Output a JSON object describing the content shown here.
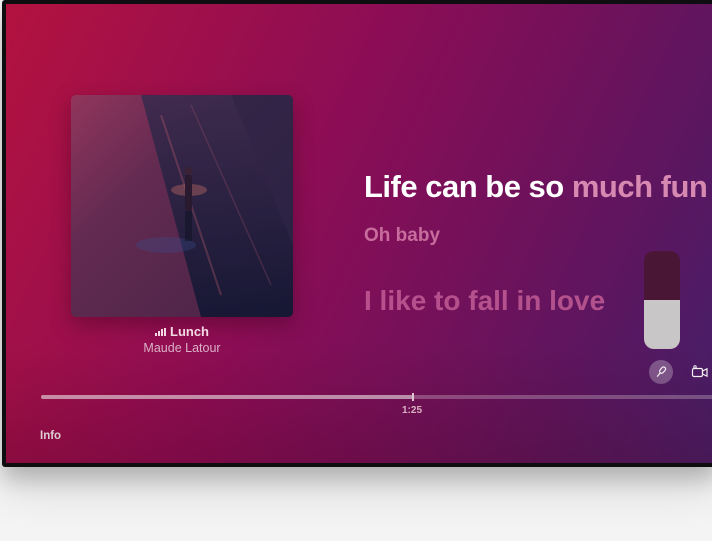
{
  "now_playing": {
    "title": "Lunch",
    "artist": "Maude Latour",
    "playing_indicator_icon": "equalizer-bars-icon"
  },
  "lyrics": {
    "current_sung": "Life can be so",
    "current_unsung": " much fun",
    "next": "Oh baby",
    "later": "I like to fall in love"
  },
  "playback": {
    "elapsed": "1:25",
    "progress": 0.55
  },
  "controls": {
    "info_label": "Info",
    "mic_icon": "microphone-icon",
    "camera_icon": "video-camera-icon",
    "mic_volume_level": 0.5
  },
  "colors": {
    "background_start": "#b3123f",
    "background_end": "#43206a",
    "lyric_highlight": "#ffffff",
    "lyric_dim": "#d889b2"
  }
}
